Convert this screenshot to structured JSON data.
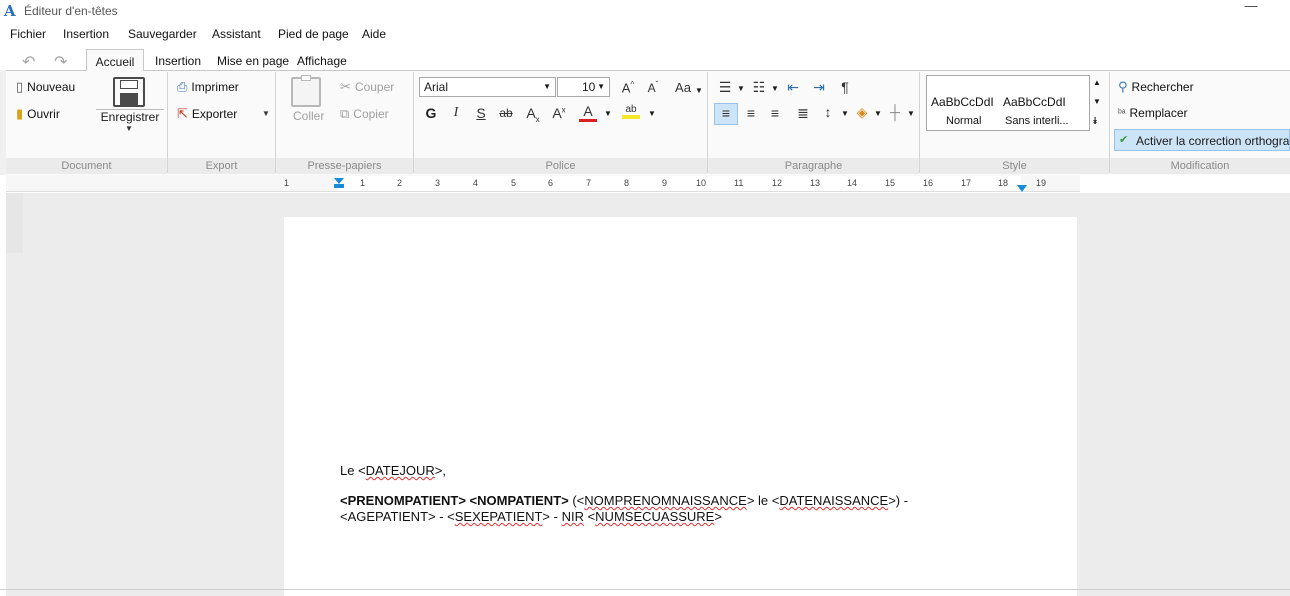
{
  "window": {
    "title": "Éditeur d'en-têtes",
    "minimize": "—"
  },
  "menu": [
    "Fichier",
    "Insertion",
    "Sauvegarder",
    "Assistant",
    "Pied de page",
    "Aide"
  ],
  "tabs": [
    "Accueil",
    "Insertion",
    "Mise en page",
    "Affichage"
  ],
  "groups": {
    "document": {
      "label": "Document",
      "new": "Nouveau",
      "open": "Ouvrir",
      "save": "Enregistrer"
    },
    "export": {
      "label": "Export",
      "print": "Imprimer",
      "export": "Exporter"
    },
    "clipboard": {
      "label": "Presse-papiers",
      "paste": "Coller",
      "cut": "Couper",
      "copy": "Copier"
    },
    "font": {
      "label": "Police",
      "font_name": "Arial",
      "font_size": "10",
      "bold": "G",
      "italic": "I",
      "strike": "S",
      "abstrike": "ab",
      "case": "Aa",
      "grow": "A",
      "shrink": "A",
      "color": "A"
    },
    "paragraph": {
      "label": "Paragraphe",
      "pilcrow": "¶"
    },
    "style": {
      "label": "Style",
      "items": [
        {
          "preview": "AaBbCcDdI",
          "name": "Normal"
        },
        {
          "preview": "AaBbCcDdI",
          "name": "Sans interli..."
        }
      ]
    },
    "modification": {
      "label": "Modification",
      "find": "Rechercher",
      "replace": "Remplacer",
      "spell": "Activer la correction orthographique"
    }
  },
  "ruler": [
    "1",
    "1",
    "2",
    "3",
    "4",
    "5",
    "6",
    "7",
    "8",
    "9",
    "10",
    "11",
    "12",
    "13",
    "14",
    "15",
    "16",
    "17",
    "18",
    "19"
  ],
  "document": {
    "line1_pre": "Le <",
    "line1_field": "DATEJOUR",
    "line1_post": ">,",
    "bold_part": "<PRENOMPATIENT> <NOMPATIENT>",
    "l2_a": " (<",
    "l2_f1": "NOMPRENOMNAISSANCE",
    "l2_b": "> le <",
    "l2_f2": "DATENAISSANCE",
    "l2_c": ">) -",
    "l3_a": "<AGEPATIENT> - <",
    "l3_f1": "SEXEPATIENT",
    "l3_b": "> - ",
    "l3_f2": "NIR",
    "l3_c": "  <",
    "l3_f3": "NUMSECUASSURE",
    "l3_d": ">"
  }
}
